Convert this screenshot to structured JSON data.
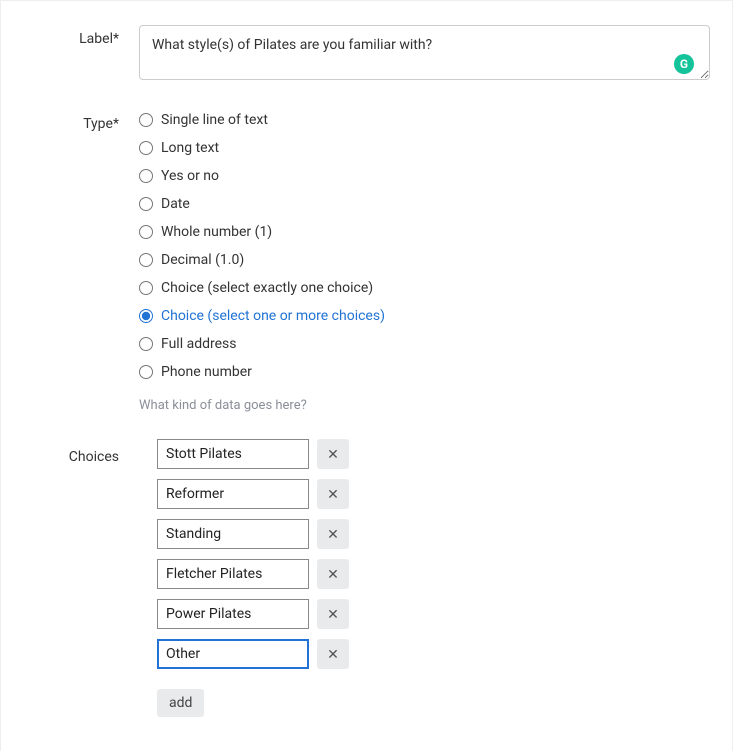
{
  "labels": {
    "label_field": "Label*",
    "type_field": "Type*",
    "choices_field": "Choices"
  },
  "form": {
    "label_value": "What style(s) of Pilates are you familiar with?"
  },
  "types": {
    "selected_index": 7,
    "options": [
      "Single line of text",
      "Long text",
      "Yes or no",
      "Date",
      "Whole number (1)",
      "Decimal (1.0)",
      "Choice (select exactly one choice)",
      "Choice (select one or more choices)",
      "Full address",
      "Phone number"
    ],
    "hint": "What kind of data goes here?"
  },
  "choices": {
    "items": [
      "Stott Pilates",
      "Reformer",
      "Standing",
      "Fletcher Pilates",
      "Power Pilates",
      "Other"
    ],
    "active_index": 5
  },
  "buttons": {
    "add": "add",
    "remove_glyph": "✕"
  },
  "badges": {
    "grammarly_glyph": "G"
  }
}
